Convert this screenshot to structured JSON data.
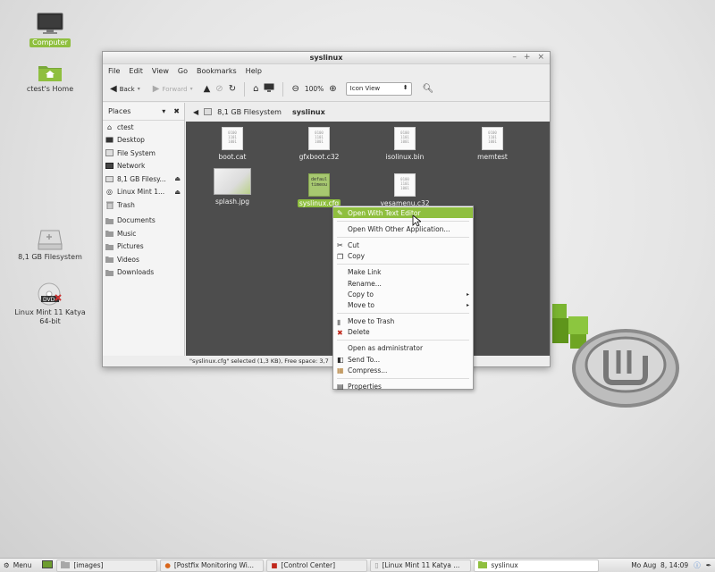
{
  "desktop": {
    "icons": [
      {
        "label": "Computer",
        "icon": "computer-icon"
      },
      {
        "label": "ctest's Home",
        "icon": "home-folder-icon"
      },
      {
        "label": "8,1 GB Filesystem",
        "icon": "drive-icon"
      },
      {
        "label": "Linux Mint 11 Katya\n64-bit",
        "icon": "dvd-icon"
      }
    ]
  },
  "window": {
    "title": "syslinux",
    "menu": [
      "File",
      "Edit",
      "View",
      "Go",
      "Bookmarks",
      "Help"
    ],
    "toolbar": {
      "back": "Back",
      "forward": "Forward",
      "zoom": "100%",
      "view_mode": "Icon View"
    },
    "sidebar": {
      "header": "Places",
      "items": [
        {
          "label": "ctest",
          "icon": "home-icon"
        },
        {
          "label": "Desktop",
          "icon": "desktop-icon"
        },
        {
          "label": "File System",
          "icon": "filesystem-icon"
        },
        {
          "label": "Network",
          "icon": "network-icon"
        },
        {
          "label": "8,1 GB Filesy...",
          "icon": "drive-icon",
          "eject": true
        },
        {
          "label": "Linux Mint 1...",
          "icon": "disc-icon",
          "eject": true
        },
        {
          "label": "Trash",
          "icon": "trash-icon"
        }
      ],
      "bookmarks": [
        {
          "label": "Documents",
          "icon": "folder-icon"
        },
        {
          "label": "Music",
          "icon": "folder-icon"
        },
        {
          "label": "Pictures",
          "icon": "folder-icon"
        },
        {
          "label": "Videos",
          "icon": "folder-icon"
        },
        {
          "label": "Downloads",
          "icon": "folder-icon"
        }
      ]
    },
    "path": {
      "parent": "8,1 GB Filesystem",
      "current": "syslinux"
    },
    "files": [
      {
        "name": "boot.cat",
        "kind": "binary"
      },
      {
        "name": "gfxboot.c32",
        "kind": "binary"
      },
      {
        "name": "isolinux.bin",
        "kind": "binary"
      },
      {
        "name": "memtest",
        "kind": "binary"
      },
      {
        "name": "splash.jpg",
        "kind": "image"
      },
      {
        "name": "syslinux.cfg",
        "kind": "text",
        "selected": true,
        "preview": "defaul\ntimeou"
      },
      {
        "name": "vesamenu.c32",
        "kind": "binary"
      }
    ],
    "binary_glyph": "0100\n1101\n1001",
    "status": "\"syslinux.cfg\" selected (1,3 KB), Free space: 3,7"
  },
  "context_menu": {
    "items": [
      {
        "label": "Open With Text Editor",
        "icon": "text-editor-icon",
        "highlighted": true
      },
      {
        "sep": true
      },
      {
        "label": "Open With Other Application..."
      },
      {
        "sep": true
      },
      {
        "label": "Cut",
        "icon": "cut-icon"
      },
      {
        "label": "Copy",
        "icon": "copy-icon"
      },
      {
        "sep": true
      },
      {
        "label": "Make Link"
      },
      {
        "label": "Rename..."
      },
      {
        "label": "Copy to",
        "submenu": true
      },
      {
        "label": "Move to",
        "submenu": true
      },
      {
        "sep": true
      },
      {
        "label": "Move to Trash",
        "icon": "trash-icon"
      },
      {
        "label": "Delete",
        "icon": "delete-icon"
      },
      {
        "sep": true
      },
      {
        "label": "Open as administrator"
      },
      {
        "label": "Send To...",
        "icon": "send-icon"
      },
      {
        "label": "Compress...",
        "icon": "archive-icon"
      },
      {
        "sep": true
      },
      {
        "label": "Properties",
        "icon": "properties-icon"
      }
    ]
  },
  "taskbar": {
    "menu_label": "Menu",
    "windows": [
      {
        "label": "[images]",
        "icon": "folder-icon"
      },
      {
        "label": "[Postfix Monitoring Wi...",
        "icon": "firefox-icon"
      },
      {
        "label": "[Control Center]",
        "icon": "control-center-icon"
      },
      {
        "label": "[Linux Mint 11 Katya ...",
        "icon": "document-icon"
      },
      {
        "label": "syslinux",
        "icon": "folder-icon",
        "active": true
      }
    ],
    "clock": "Mo Aug  8, 14:09"
  },
  "colors": {
    "accent": "#8fbf3f",
    "content_bg": "#4d4d4d"
  }
}
